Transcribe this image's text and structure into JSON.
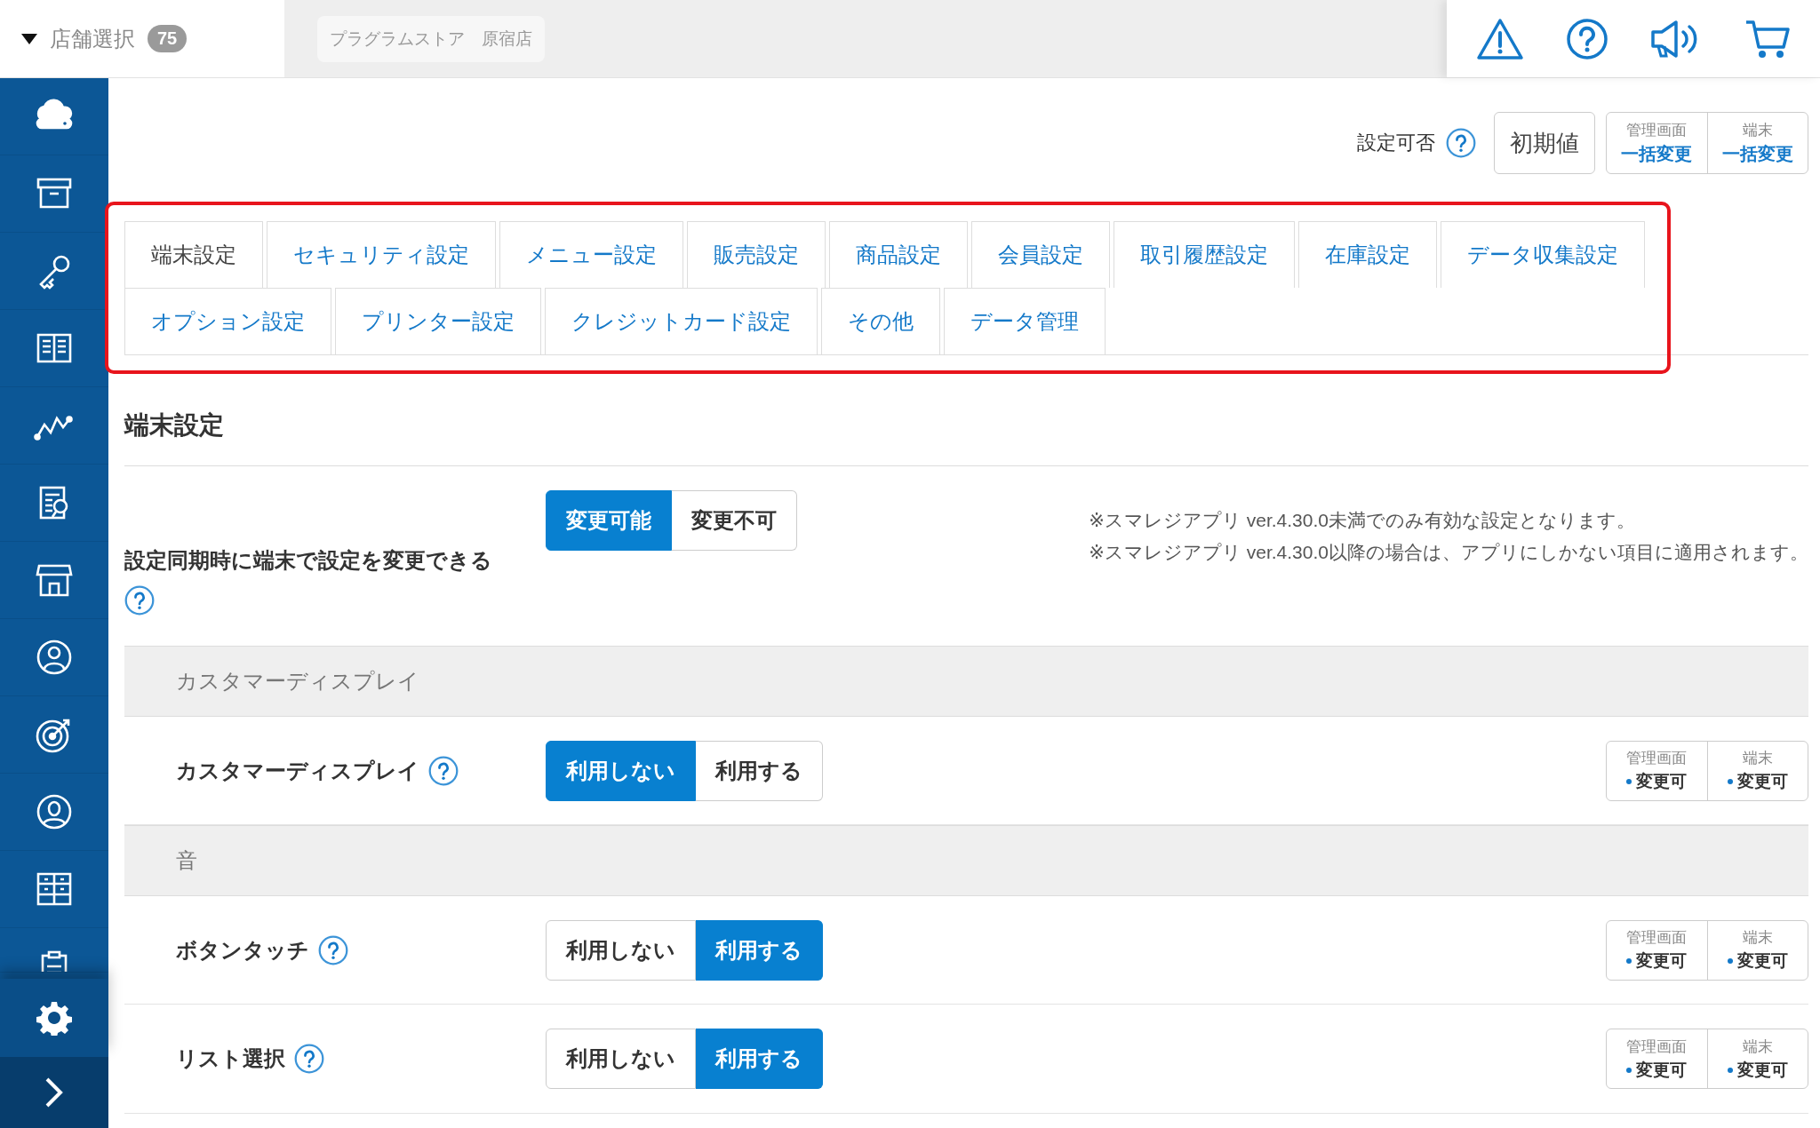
{
  "header": {
    "store_selector": {
      "label": "店舗選択",
      "count": "75"
    },
    "store_name": "プラグラムストア　原宿店"
  },
  "settings_toolbar": {
    "label": "設定可否",
    "reset_button": "初期値",
    "bulk_change": [
      {
        "title": "管理画面",
        "action": "一括変更"
      },
      {
        "title": "端末",
        "action": "一括変更"
      }
    ]
  },
  "tabs_highlighted": true,
  "tab_rows": [
    {
      "tabs": [
        {
          "label": "端末設定",
          "selected": true
        },
        {
          "label": "セキュリティ設定",
          "selected": false
        },
        {
          "label": "メニュー設定",
          "selected": false
        },
        {
          "label": "販売設定",
          "selected": false
        },
        {
          "label": "商品設定",
          "selected": false
        },
        {
          "label": "会員設定",
          "selected": false
        },
        {
          "label": "取引履歴設定",
          "selected": false
        },
        {
          "label": "在庫設定",
          "selected": false
        },
        {
          "label": "データ収集設定",
          "selected": false
        }
      ]
    },
    {
      "tabs": [
        {
          "label": "オプション設定",
          "selected": false
        },
        {
          "label": "プリンター設定",
          "selected": false
        },
        {
          "label": "クレジットカード設定",
          "selected": false
        },
        {
          "label": "その他",
          "selected": false
        },
        {
          "label": "データ管理",
          "selected": false
        }
      ]
    }
  ],
  "section_title": "端末設定",
  "sync_setting": {
    "label": "設定同期時に端末で設定を変更できる",
    "options": [
      {
        "label": "変更可能",
        "selected": true
      },
      {
        "label": "変更不可",
        "selected": false
      }
    ],
    "notes": [
      "※スマレジアプリ ver.4.30.0未満でのみ有効な設定となります。",
      "※スマレジアプリ ver.4.30.0以降の場合は、アプリにしかない項目に適用されます。"
    ]
  },
  "groups": [
    {
      "title": "カスタマーディスプレイ",
      "rows": [
        {
          "label": "カスタマーディスプレイ",
          "options": [
            {
              "label": "利用しない",
              "selected": true
            },
            {
              "label": "利用する",
              "selected": false
            }
          ],
          "permissions": [
            {
              "title": "管理画面",
              "value": "変更可"
            },
            {
              "title": "端末",
              "value": "変更可"
            }
          ]
        }
      ]
    },
    {
      "title": "音",
      "rows": [
        {
          "label": "ボタンタッチ",
          "options": [
            {
              "label": "利用しない",
              "selected": false
            },
            {
              "label": "利用する",
              "selected": true
            }
          ],
          "permissions": [
            {
              "title": "管理画面",
              "value": "変更可"
            },
            {
              "title": "端末",
              "value": "変更可"
            }
          ]
        },
        {
          "label": "リスト選択",
          "options": [
            {
              "label": "利用しない",
              "selected": false
            },
            {
              "label": "利用する",
              "selected": true
            }
          ],
          "permissions": [
            {
              "title": "管理画面",
              "value": "変更可"
            },
            {
              "title": "端末",
              "value": "変更可"
            }
          ]
        }
      ]
    }
  ]
}
